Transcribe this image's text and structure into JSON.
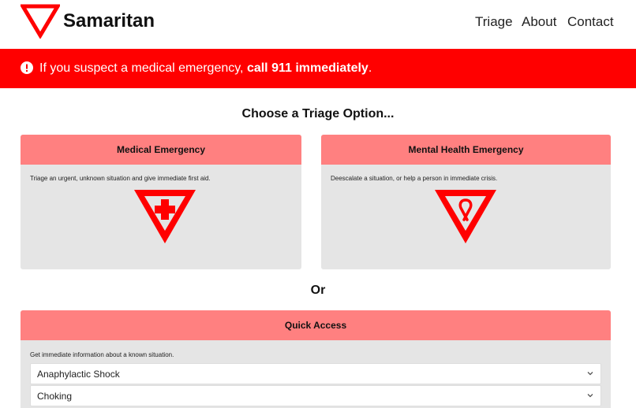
{
  "app": {
    "brand": "Samaritan",
    "logo_icon": "inverted-triangle-logo",
    "brand_color": "#ff0000"
  },
  "nav": {
    "items": [
      "Triage",
      "About",
      "Contact"
    ]
  },
  "alert": {
    "icon": "exclamation-circle-icon",
    "text_before": "If you suspect a medical emergency, ",
    "text_bold": "call 911 immediately",
    "text_after": ".",
    "background": "#ff0000"
  },
  "triage": {
    "heading": "Choose a Triage Option...",
    "options": [
      {
        "title": "Medical Emergency",
        "description": "Triage an urgent, unknown situation and give immediate first aid.",
        "icon": "first-aid-cross-icon"
      },
      {
        "title": "Mental Health Emergency",
        "description": "Deescalate a situation, or help a person in immediate crisis.",
        "icon": "awareness-ribbon-icon"
      }
    ],
    "header_color": "#ff8080",
    "card_color": "#e5e5e5"
  },
  "divider": {
    "label": "Or"
  },
  "quick_access": {
    "title": "Quick Access",
    "description": "Get immediate information about a known situation.",
    "options": [
      "Anaphylactic Shock",
      "Choking"
    ]
  }
}
